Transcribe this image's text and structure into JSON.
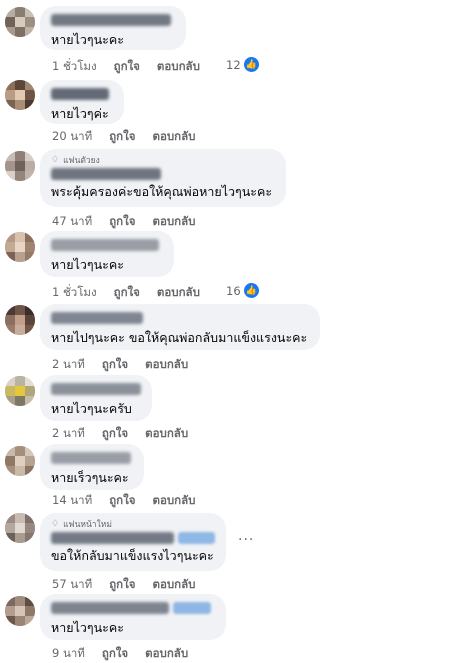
{
  "comments": [
    {
      "text": "หายไวๆนะคะ",
      "time": "1 ชั่วโมง",
      "like": "ถูกใจ",
      "reply": "ตอบกลับ",
      "reactions": "12"
    },
    {
      "text": "หายไวๆค่ะ",
      "time": "20 นาที",
      "like": "ถูกใจ",
      "reply": "ตอบกลับ"
    },
    {
      "badge": "แฟนตัวยง",
      "text": "พระคุ้มครองค่ะขอให้คุณพ่อหายไวๆนะคะ",
      "time": "47 นาที",
      "like": "ถูกใจ",
      "reply": "ตอบกลับ"
    },
    {
      "text": "หายไวๆนะคะ",
      "time": "1 ชั่วโมง",
      "like": "ถูกใจ",
      "reply": "ตอบกลับ",
      "reactions": "16"
    },
    {
      "text": "หายไปๆนะคะ ขอให้คุณพ่อกลับมาแข็งแรงนะคะ",
      "time": "2 นาที",
      "like": "ถูกใจ",
      "reply": "ตอบกลับ"
    },
    {
      "text": "หายไวๆนะครับ",
      "time": "2 นาที",
      "like": "ถูกใจ",
      "reply": "ตอบกลับ"
    },
    {
      "text": "หายเร็วๆนะคะ",
      "time": "14 นาที",
      "like": "ถูกใจ",
      "reply": "ตอบกลับ"
    },
    {
      "badge": "แฟนหน้าใหม่",
      "text": "ขอให้กลับมาแข็งแรงไวๆนะคะ",
      "time": "57 นาที",
      "like": "ถูกใจ",
      "reply": "ตอบกลับ",
      "more": "···"
    },
    {
      "text": "หายไวๆนะคะ",
      "time": "9 นาที",
      "like": "ถูกใจ",
      "reply": "ตอบกลับ"
    }
  ],
  "icons": {
    "like_reaction": "thumbs-up-icon",
    "fan_badge": "diamond-badge-icon"
  },
  "colors": {
    "bubble": "#f0f2f5",
    "secondary_text": "#65676b",
    "reaction_blue": "#1877f2"
  }
}
